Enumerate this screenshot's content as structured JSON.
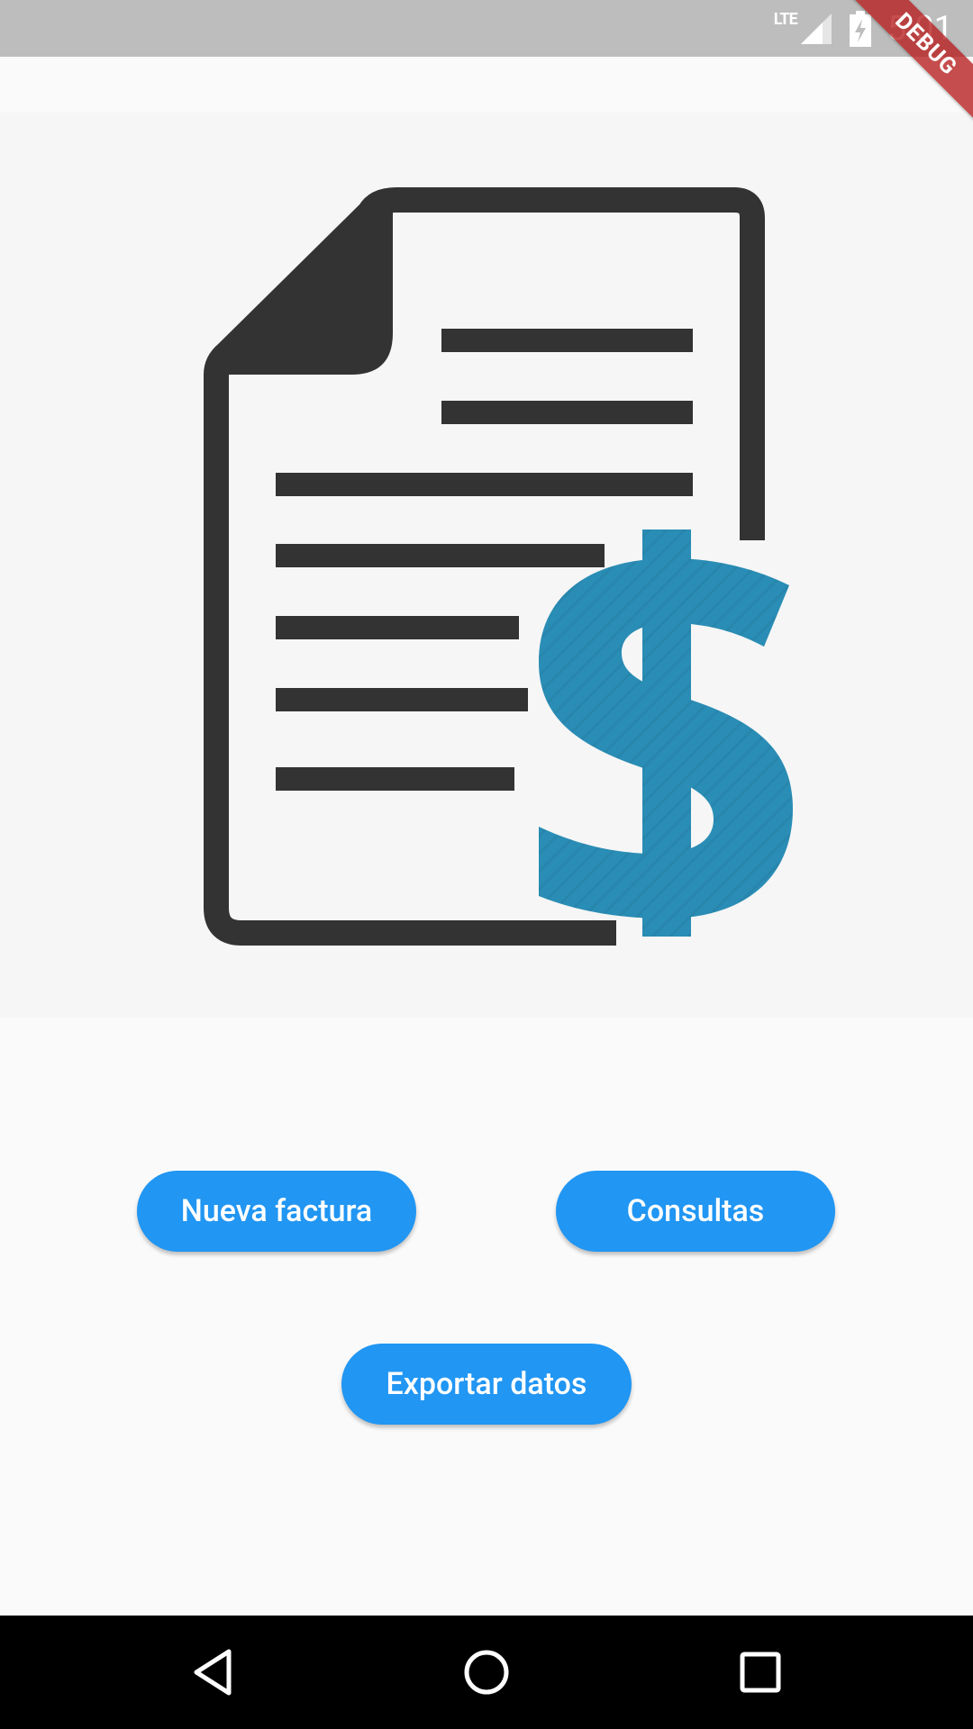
{
  "status_bar": {
    "network": "LTE",
    "time": "5:01"
  },
  "debug_banner": "DEBUG",
  "colors": {
    "primary": "#2196f3",
    "document_stroke": "#333333",
    "dollar": "#2a8db5",
    "status_bar": "#bdbdbd",
    "nav_bar": "#000000"
  },
  "hero_image": {
    "icon": "invoice-document-dollar-icon"
  },
  "buttons": {
    "nueva_factura": "Nueva factura",
    "consultas": "Consultas",
    "exportar_datos": "Exportar datos"
  },
  "nav": {
    "back_icon": "back-triangle-icon",
    "home_icon": "home-circle-icon",
    "recent_icon": "recent-apps-square-icon"
  }
}
